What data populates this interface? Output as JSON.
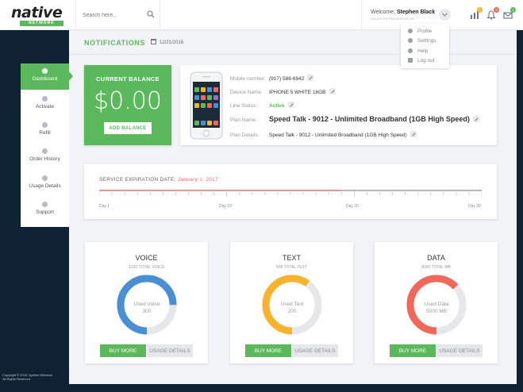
{
  "brand": {
    "logo_text": "native",
    "logo_sub": "NETWORK",
    "accent": "#5cb85c"
  },
  "search": {
    "placeholder": "Search here..."
  },
  "user": {
    "welcome_prefix": "Welcome, ",
    "name": "Stephen Black",
    "sub": "SALES REPRESENTATIVE"
  },
  "notifications": {
    "badges": [
      "1",
      "3",
      "1"
    ]
  },
  "user_menu": [
    {
      "label": "Profile",
      "icon": "user-icon"
    },
    {
      "label": "Settings",
      "icon": "gear-icon"
    },
    {
      "label": "Help",
      "icon": "help-icon"
    },
    {
      "label": "Log out",
      "icon": "logout-icon"
    }
  ],
  "header": {
    "title": "NOTIFICATIONS",
    "date": "12/21/2016"
  },
  "sidebar": {
    "items": [
      {
        "label": "Dashboard",
        "icon": "dashboard-icon",
        "active": true
      },
      {
        "label": "Activate",
        "icon": "activate-icon"
      },
      {
        "label": "Refill",
        "icon": "refill-icon"
      },
      {
        "label": "Order History",
        "icon": "order-history-icon"
      },
      {
        "label": "Usage Details",
        "icon": "usage-details-icon"
      },
      {
        "label": "Support",
        "icon": "support-icon"
      }
    ]
  },
  "balance": {
    "title": "CURRENT BALANCE",
    "amount": "$0.00",
    "button": "ADD BALANCE"
  },
  "device": {
    "rows": [
      {
        "label": "Mobile number:",
        "value": "(917) 588-6942"
      },
      {
        "label": "Device Name:",
        "value": "IPHONE 5 WHITE 16GB"
      },
      {
        "label": "Line Status:",
        "value": "Active"
      },
      {
        "label": "Plan Name:",
        "value": "Speed Talk - 9012 - Unlimited Broadband (1GB High Speed)"
      },
      {
        "label": "Plan Details:",
        "value": "Speed Talk - 9012 - Unlimited Broadband (1GB High Speed)"
      }
    ]
  },
  "expiration": {
    "title": "SERVICE EXPIRATION DATE:",
    "date": "January 1, 2017",
    "ticks": [
      "Day 1",
      "Day 10",
      "Day 20",
      "Day 30"
    ],
    "progress_fraction": 0.63
  },
  "usage": [
    {
      "title": "VOICE",
      "sub": "1220 TOTAL VOICE",
      "used_label": "Used Voice",
      "used_value": "300",
      "color": "#4a8ed4",
      "fraction": 0.75,
      "buy": "BUY MORE",
      "details": "USAGE DETAILS"
    },
    {
      "title": "TEXT",
      "sub": "508 TOTAL TEXT",
      "used_label": "Used Text",
      "used_value": "200",
      "color": "#f7b32b",
      "fraction": 0.6,
      "buy": "BUY MORE",
      "details": "USAGE DETAILS"
    },
    {
      "title": "DATA",
      "sub": "8000 TOTAL MB",
      "used_label": "Used Data",
      "used_value": "5000 MB",
      "color": "#f0685c",
      "fraction": 0.63,
      "buy": "BUY MORE",
      "details": "USAGE DETAILS"
    }
  ],
  "footer": {
    "line1": "Copyright © 2016. Ignition Wireless.",
    "line2": "All Rights Reserved."
  }
}
